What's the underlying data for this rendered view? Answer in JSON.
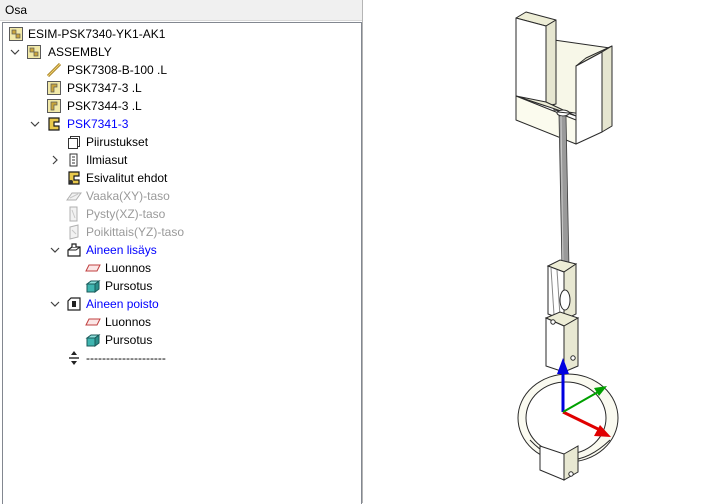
{
  "panel": {
    "title": "Osa"
  },
  "tree": {
    "items": [
      {
        "label": "ESIM-PSK7340-YK1-AK1"
      },
      {
        "label": "ASSEMBLY"
      },
      {
        "label": "PSK7308-B-100 .L"
      },
      {
        "label": "PSK7347-3 .L"
      },
      {
        "label": "PSK7344-3 .L"
      },
      {
        "label": "PSK7341-3"
      },
      {
        "label": "Piirustukset"
      },
      {
        "label": "Ilmiasut"
      },
      {
        "label": "Esivalitut ehdot"
      },
      {
        "label": "Vaaka(XY)-taso"
      },
      {
        "label": "Pysty(XZ)-taso"
      },
      {
        "label": "Poikittais(YZ)-taso"
      },
      {
        "label": "Aineen lisäys"
      },
      {
        "label": "Luonnos"
      },
      {
        "label": "Pursotus"
      },
      {
        "label": "Aineen poisto"
      },
      {
        "label": "Luonnos"
      },
      {
        "label": "Pursotus"
      },
      {
        "label": "--------------------"
      }
    ]
  },
  "colors": {
    "active_text": "#0000ff",
    "disabled_text": "#9a9a9a",
    "axis_x": "#e00000",
    "axis_y": "#00a000",
    "axis_z": "#0000e0"
  }
}
